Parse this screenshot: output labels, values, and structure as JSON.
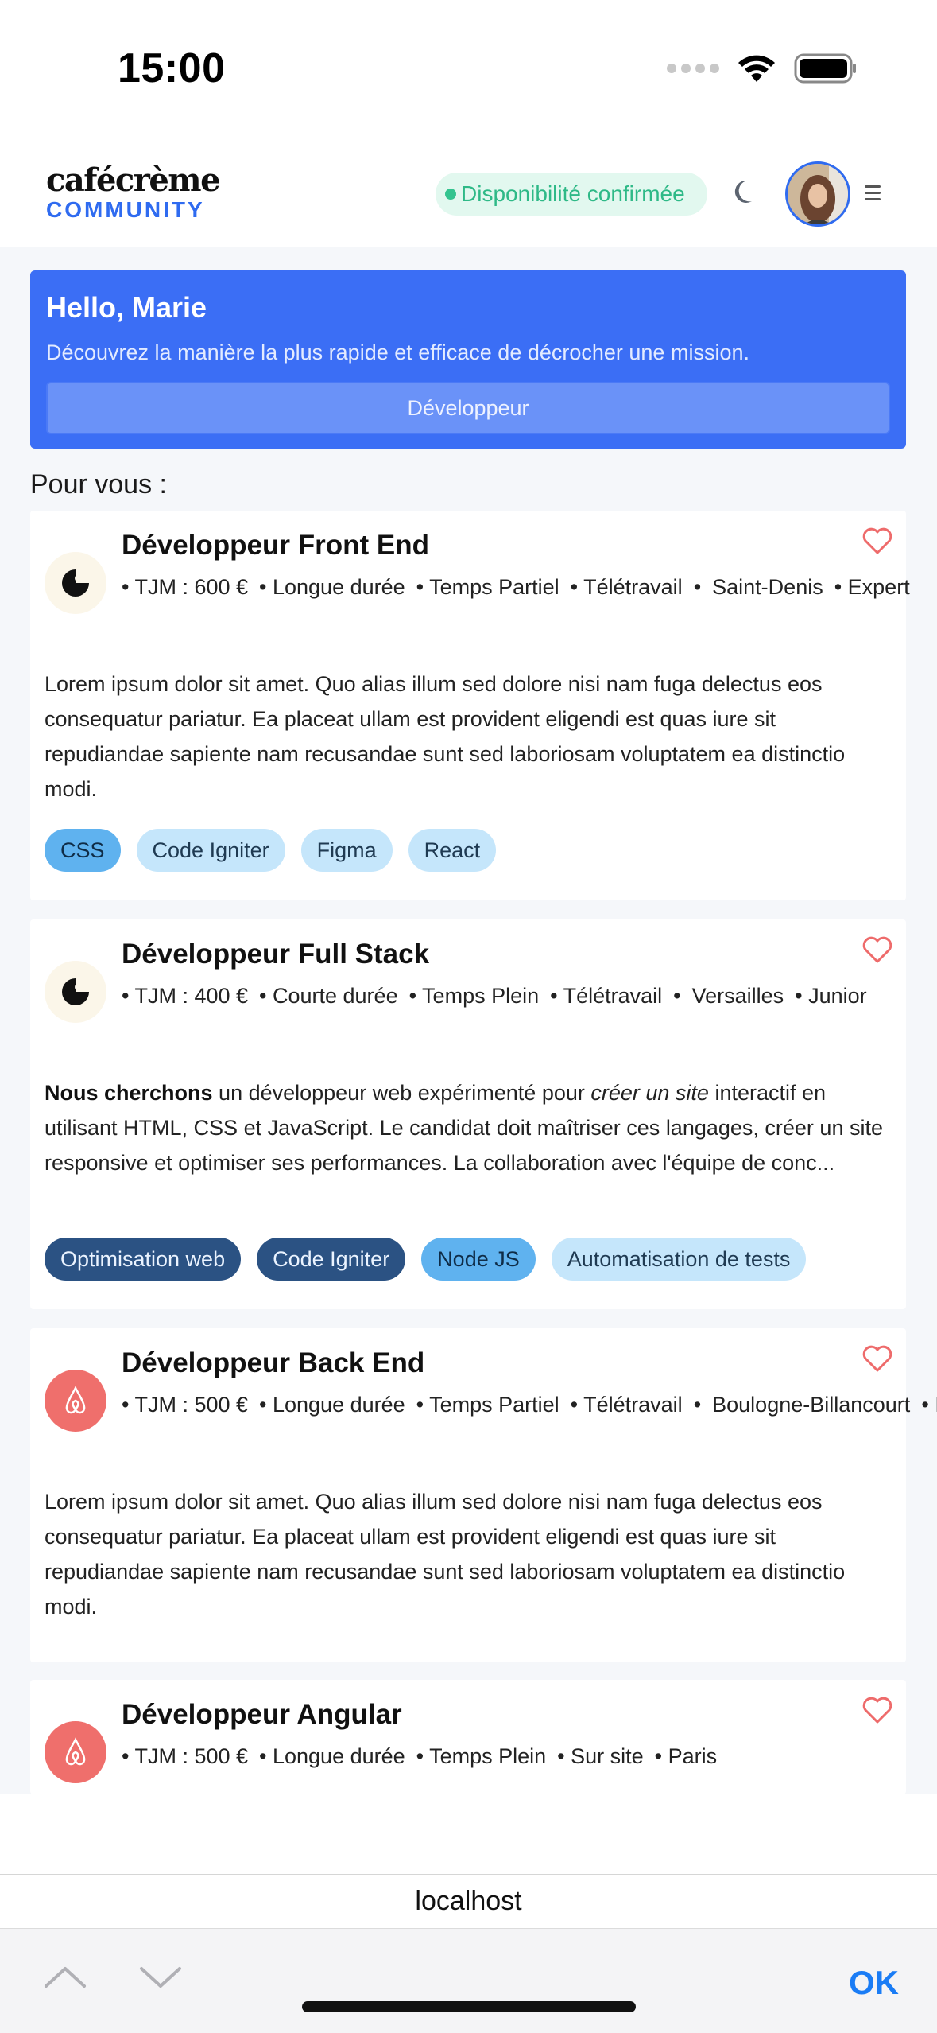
{
  "status_bar": {
    "time": "15:00"
  },
  "header": {
    "logo_top": "cafécrème",
    "logo_bottom": "COMMUNITY",
    "availability": "Disponibilité confirmée"
  },
  "hero": {
    "greeting": "Hello, Marie",
    "subtitle": "Découvrez la manière la plus rapide et efficace de décrocher une mission.",
    "selected_role": "Développeur"
  },
  "section_title": "Pour vous :",
  "jobs": [
    {
      "title": "Développeur Front End",
      "meta": [
        "• TJM : 600 €",
        "• Longue durée",
        "• Temps Partiel",
        "• Télétravail",
        "•",
        "Saint-Denis",
        "• Expert"
      ],
      "description": "Lorem ipsum dolor sit amet. Quo alias illum sed dolore nisi nam fuga delectus eos consequatur pariatur. Ea placeat ullam est provident eligendi est quas iure sit repudiandae sapiente nam recusandae sunt sed laboriosam voluptatem ea distinctio modi.",
      "tags": [
        "CSS",
        "Code Igniter",
        "Figma",
        "React"
      ]
    },
    {
      "title": "Développeur Full Stack",
      "meta": [
        "• TJM : 400 €",
        "• Courte durée",
        "• Temps Plein",
        "• Télétravail",
        "•",
        "Versailles",
        "• Junior"
      ],
      "description_parts": {
        "bold": "Nous cherchons",
        "text1": " un développeur web expérimenté pour ",
        "italic": "créer un site",
        "text2": " interactif en utilisant HTML, CSS et JavaScript. Le candidat doit maîtriser ces langages, créer un site responsive et optimiser ses performances. La collaboration avec l'équipe de conc..."
      },
      "tags": [
        "Optimisation web",
        "Code Igniter",
        "Node JS",
        "Automatisation de tests"
      ]
    },
    {
      "title": "Développeur Back End",
      "meta": [
        "• TJM : 500 €",
        "• Longue durée",
        "• Temps Partiel",
        "• Télétravail",
        "•",
        "Boulogne-Billancourt",
        "• Intermédiaire"
      ],
      "description": "Lorem ipsum dolor sit amet. Quo alias illum sed dolore nisi nam fuga delectus eos consequatur pariatur. Ea placeat ullam est provident eligendi est quas iure sit repudiandae sapiente nam recusandae sunt sed laboriosam voluptatem ea distinctio modi."
    },
    {
      "title": "Développeur Angular",
      "meta": [
        "• TJM : 500 €",
        "• Longue durée",
        "• Temps Plein",
        "• Sur site",
        "• Paris"
      ]
    }
  ],
  "browser": {
    "url": "localhost",
    "ok_label": "OK"
  },
  "colors": {
    "accent": "#3b6ef5",
    "availability": "#2eb987",
    "heart": "#ee6b6b",
    "ok": "#1a7cf5"
  }
}
